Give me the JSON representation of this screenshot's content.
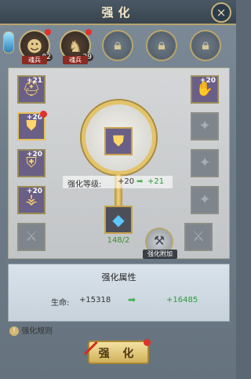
{
  "window": {
    "title": "强化",
    "close_icon": "close-icon"
  },
  "heroes": [
    {
      "name": "魂兵",
      "level": "82",
      "icon": "warrior-portrait",
      "badge": true
    },
    {
      "name": "魂兵",
      "level": "29",
      "icon": "beast-portrait",
      "badge": true
    },
    {
      "icon": "lock-icon"
    },
    {
      "icon": "lock-icon"
    },
    {
      "icon": "lock-icon"
    }
  ],
  "left_slots": [
    {
      "level": "+21",
      "icon": "helmet-icon",
      "badge": false
    },
    {
      "level": "+20",
      "icon": "shoulder-armor-icon",
      "badge": true
    },
    {
      "level": "+20",
      "icon": "chest-armor-icon",
      "badge": false
    },
    {
      "level": "+20",
      "icon": "leg-armor-icon",
      "badge": false
    },
    {
      "level": "",
      "icon": "locked-weapon-icon",
      "badge": false
    }
  ],
  "right_slots": [
    {
      "level": "+20",
      "icon": "gauntlet-icon",
      "badge": false
    },
    {
      "level": "",
      "icon": "locked-slot-icon",
      "badge": false
    },
    {
      "level": "",
      "icon": "locked-slot-icon",
      "badge": false
    },
    {
      "level": "",
      "icon": "locked-slot-icon",
      "badge": false
    },
    {
      "level": "",
      "icon": "locked-weapon-icon",
      "badge": false
    }
  ],
  "center": {
    "item_icon": "shoulder-armor-icon",
    "level_label": "强化等级:",
    "current_level": "+20",
    "next_level": "+21",
    "material_icon": "blue-crystal-icon",
    "material_count": "148/2",
    "attach_label": "强化附加"
  },
  "attributes": {
    "title": "强化属性",
    "stat_label": "生命:",
    "current_value": "+15318",
    "next_value": "+16485"
  },
  "rules_label": "强化规则",
  "enhance_button": "强 化"
}
